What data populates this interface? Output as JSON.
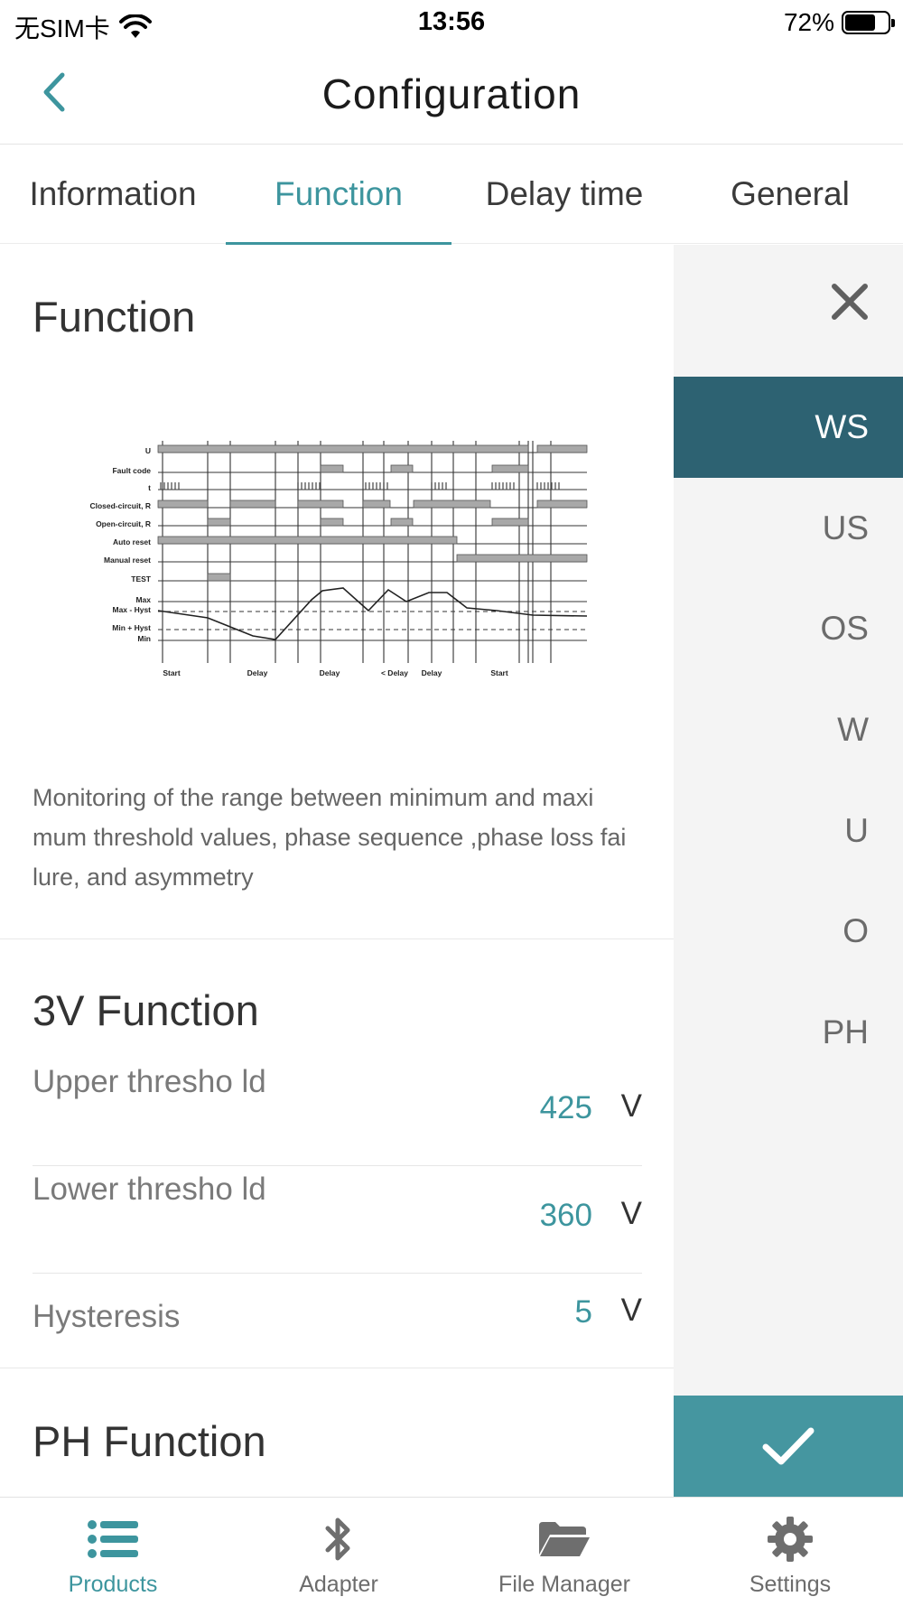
{
  "status_bar": {
    "carrier": "无SIM卡",
    "time": "13:56",
    "battery": "72%",
    "battery_level": 0.72
  },
  "nav": {
    "title": "Configuration"
  },
  "tabs": [
    {
      "label": "Information"
    },
    {
      "label": "Function"
    },
    {
      "label": "Delay time"
    },
    {
      "label": "General"
    }
  ],
  "function_section": {
    "title": "Function",
    "diagram": {
      "row_labels": [
        "U",
        "Fault code",
        "t",
        "Closed-circuit, R",
        "Open-circuit, R",
        "Auto reset",
        "Manual reset",
        "TEST",
        "Max",
        "Max - Hyst",
        "Min + Hyst",
        "Min"
      ],
      "bottom_labels": [
        "Start",
        "Delay",
        "Delay",
        "< Delay",
        "Delay",
        "Start"
      ]
    },
    "description": "Monitoring of the range between minimum and maxi mum threshold values, phase sequence ,phase loss fai lure, and asymmetry"
  },
  "v3_section": {
    "title": "3V Function",
    "rows": [
      {
        "label": "Upper thresho ld",
        "value": "425",
        "unit": "V"
      },
      {
        "label": "Lower thresho ld",
        "value": "360",
        "unit": "V"
      },
      {
        "label": "Hysteresis",
        "value": "5",
        "unit": "V"
      }
    ]
  },
  "ph_section": {
    "title": "PH Function"
  },
  "side_list": {
    "items": [
      "WS",
      "US",
      "OS",
      "W",
      "U",
      "O",
      "PH"
    ],
    "selected": "WS"
  },
  "bottom_tabs": [
    {
      "label": "Products",
      "icon": "list-icon"
    },
    {
      "label": "Adapter",
      "icon": "bluetooth-icon"
    },
    {
      "label": "File Manager",
      "icon": "folder-icon"
    },
    {
      "label": "Settings",
      "icon": "gear-icon"
    }
  ],
  "colors": {
    "accent": "#3d959e",
    "selected_side": "#2d6272",
    "confirm": "#4596a0"
  }
}
